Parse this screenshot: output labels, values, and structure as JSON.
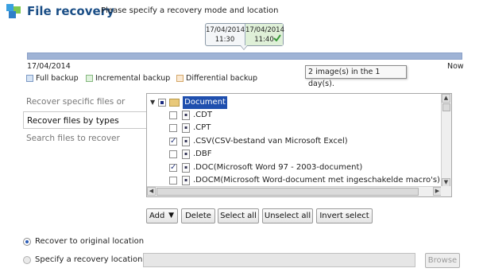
{
  "header": {
    "title": "File recovery",
    "subtitle": "Please specify a recovery mode and location"
  },
  "timeline": {
    "points": [
      {
        "date": "17/04/2014",
        "time": "11:30"
      },
      {
        "date": "17/04/2014",
        "time": "11:40"
      }
    ],
    "start_label": "17/04/2014",
    "end_label": "Now",
    "tooltip": "2 image(s) in the 1 day(s).",
    "bar_color": "#9fb3d5"
  },
  "legend": [
    {
      "label": "Full backup",
      "color": "#d6e4f5",
      "border": "#7d9ac4"
    },
    {
      "label": "Incremental backup",
      "color": "#dff2dc",
      "border": "#86b880"
    },
    {
      "label": "Differential backup",
      "color": "#fbe9d2",
      "border": "#d4a86a"
    }
  ],
  "modes": [
    {
      "label": "Recover specific files or folders",
      "selected": false
    },
    {
      "label": "Recover files by types",
      "selected": true
    },
    {
      "label": "Search files to recover",
      "selected": false
    }
  ],
  "tree": {
    "root": "Document",
    "items": [
      {
        "ext": ".CDT",
        "checked": false
      },
      {
        "ext": ".CPT",
        "checked": false
      },
      {
        "ext": ".CSV(CSV-bestand van Microsoft Excel)",
        "checked": true
      },
      {
        "ext": ".DBF",
        "checked": false
      },
      {
        "ext": ".DOC(Microsoft Word 97 - 2003-document)",
        "checked": true
      },
      {
        "ext": ".DOCM(Microsoft Word-document met ingeschakelde macro's)",
        "checked": false
      }
    ]
  },
  "buttons": {
    "add": "Add",
    "delete": "Delete",
    "select_all": "Select all",
    "unselect_all": "Unselect all",
    "invert_select": "Invert select"
  },
  "location": {
    "original": "Recover to original location",
    "specify": "Specify a recovery location:",
    "path_value": "",
    "browse": "Browse"
  }
}
